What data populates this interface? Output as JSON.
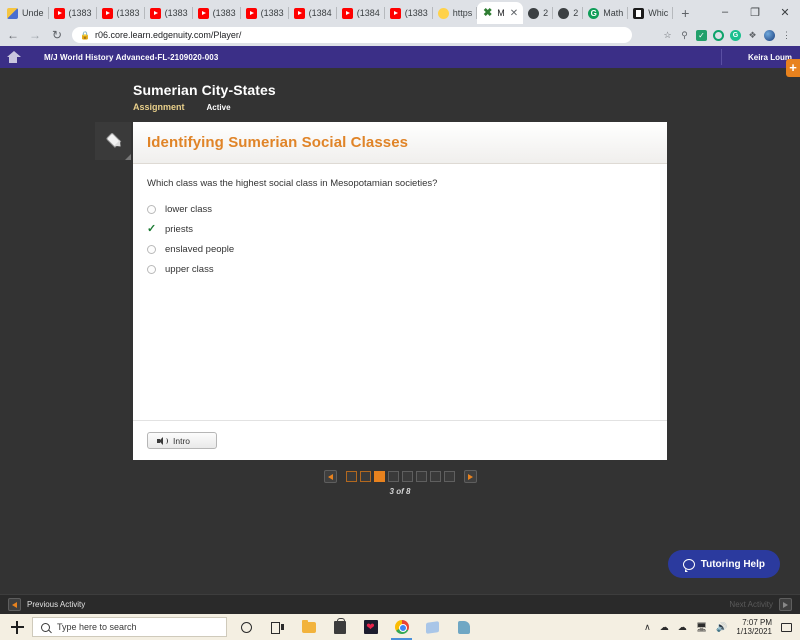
{
  "browser": {
    "tabs": [
      {
        "label": "Unde",
        "favicon": "bag-icon",
        "active": false
      },
      {
        "label": "(1383",
        "favicon": "youtube-icon",
        "active": false
      },
      {
        "label": "(1383",
        "favicon": "youtube-icon",
        "active": false
      },
      {
        "label": "(1383",
        "favicon": "youtube-icon",
        "active": false
      },
      {
        "label": "(1383",
        "favicon": "youtube-icon",
        "active": false
      },
      {
        "label": "(1383",
        "favicon": "youtube-icon",
        "active": false
      },
      {
        "label": "(1384",
        "favicon": "youtube-icon",
        "active": false
      },
      {
        "label": "(1384",
        "favicon": "youtube-icon",
        "active": false
      },
      {
        "label": "(1383",
        "favicon": "youtube-icon",
        "active": false
      },
      {
        "label": "https",
        "favicon": "bulb-icon",
        "active": false
      },
      {
        "label": "M",
        "favicon": "edgenuity-icon",
        "active": true
      },
      {
        "label": "2",
        "favicon": "globe-icon",
        "active": false
      },
      {
        "label": "2",
        "favicon": "globe-icon",
        "active": false
      },
      {
        "label": "Math",
        "favicon": "g-icon",
        "active": false
      },
      {
        "label": "Whic",
        "favicon": "doc-icon",
        "active": false
      }
    ],
    "new_tab_label": "+",
    "window_controls": {
      "minimize": "–",
      "maximize": "❐",
      "close": "✕"
    },
    "url": "r06.core.learn.edgenuity.com/Player/",
    "back_label": "←",
    "forward_label": "→",
    "reload_label": "↻",
    "bookmark_label": "☆",
    "menu_label": "⋮",
    "extension_g_label": "G"
  },
  "app_header": {
    "course_title": "M/J World History Advanced-FL-2109020-003",
    "user_name": "Keira Loum",
    "add_button_label": "+"
  },
  "lesson": {
    "title": "Sumerian City-States",
    "type_label": "Assignment",
    "status_label": "Active"
  },
  "card": {
    "heading": "Identifying Sumerian Social Classes",
    "question": "Which class was the highest social class in Mesopotamian societies?",
    "options": [
      {
        "label": "lower class",
        "selected": false
      },
      {
        "label": "priests",
        "selected": true
      },
      {
        "label": "enslaved people",
        "selected": false
      },
      {
        "label": "upper class",
        "selected": false
      }
    ],
    "audio_button_label": "Intro"
  },
  "pager": {
    "prev_label": "◀",
    "next_label": "▶",
    "count_label": "3 of 8",
    "total": 8,
    "current": 3,
    "states": [
      "visited",
      "visited",
      "current",
      "unvisited",
      "unvisited",
      "unvisited",
      "unvisited",
      "unvisited"
    ]
  },
  "tutoring": {
    "label": "Tutoring Help"
  },
  "activity_bar": {
    "previous_label": "Previous Activity",
    "next_label": "Next Activity"
  },
  "taskbar": {
    "search_placeholder": "Type here to search",
    "time": "7:07 PM",
    "date": "1/13/2021",
    "tray_caret": "∧"
  },
  "colors": {
    "brand_purple": "#3b2f87",
    "accent_orange": "#e8821e",
    "heading_orange": "#e08428",
    "correct_green": "#1a7a32",
    "tutoring_blue": "#2b3a9e"
  }
}
